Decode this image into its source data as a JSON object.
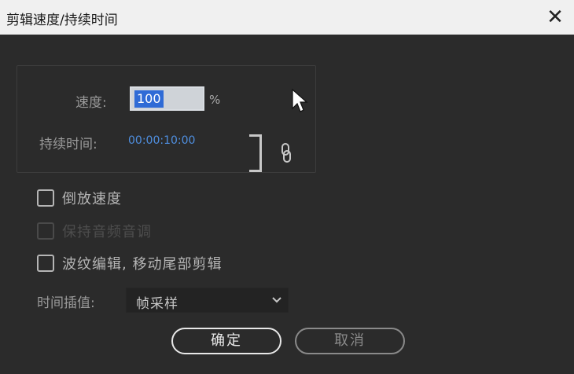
{
  "window": {
    "title": "剪辑速度/持续时间",
    "close_glyph": "✕"
  },
  "speed": {
    "label": "速度:",
    "value": "100",
    "unit": "%"
  },
  "duration": {
    "label": "持续时间:",
    "value": "00:00:10:00"
  },
  "checkboxes": {
    "reverse_speed": {
      "label": "倒放速度",
      "checked": false
    },
    "maintain_audio_pitch": {
      "label": "保持音频音调",
      "checked": false,
      "enabled": false
    },
    "ripple_edit": {
      "label": "波纹编辑, 移动尾部剪辑",
      "checked": false
    }
  },
  "time_interpolation": {
    "label": "时间插值:",
    "selected": "帧采样"
  },
  "buttons": {
    "ok": "确定",
    "cancel": "取消"
  },
  "icons": {
    "link": "chain-link-icon",
    "cursor": "mouse-pointer-icon",
    "dropdown": "chevron-down-icon",
    "close": "close-icon"
  }
}
